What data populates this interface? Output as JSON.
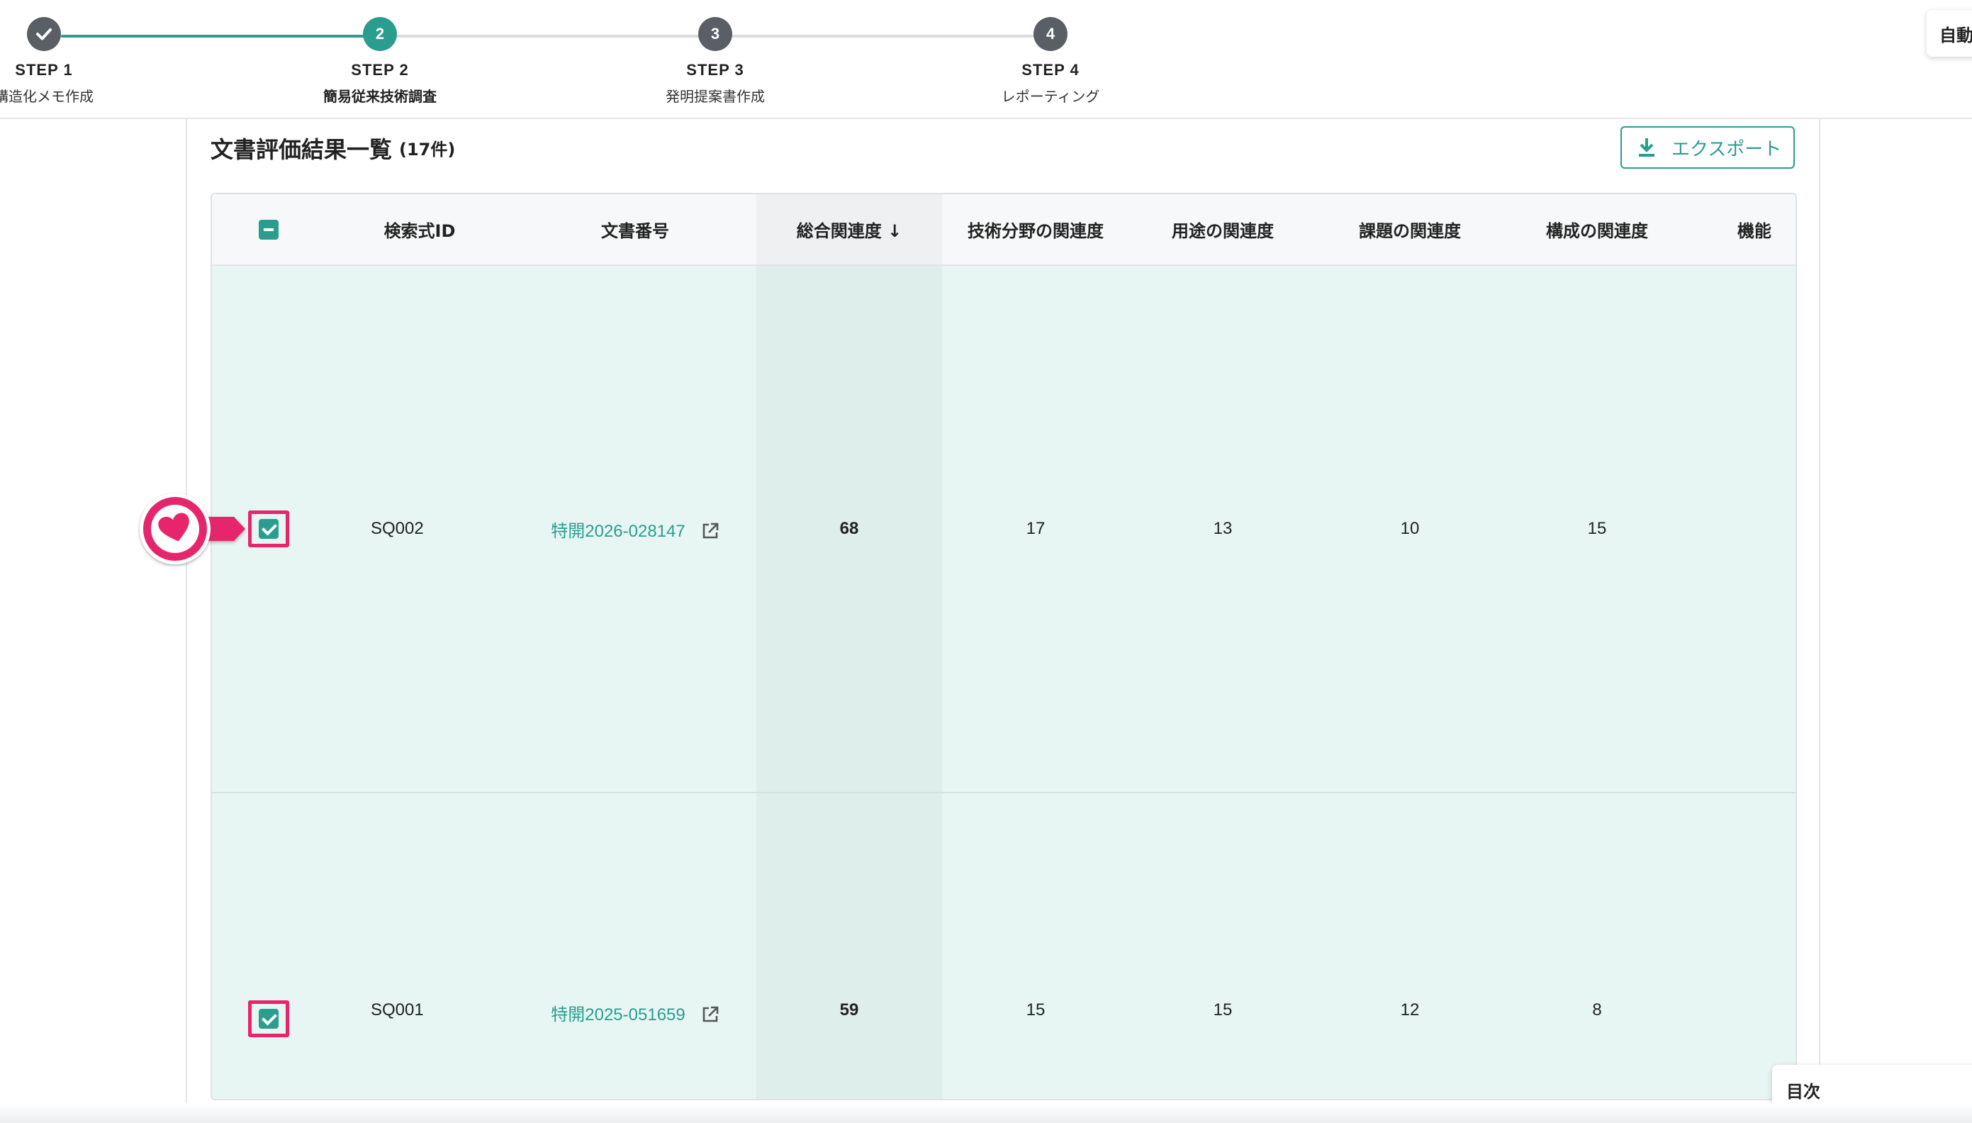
{
  "stepper": {
    "steps": [
      {
        "title": "STEP 1",
        "subtitle": "構造化メモ作成",
        "state": "done",
        "icon": "check-icon"
      },
      {
        "title": "STEP 2",
        "subtitle": "簡易従来技術調査",
        "state": "active",
        "number": "2"
      },
      {
        "title": "STEP 3",
        "subtitle": "発明提案書作成",
        "state": "todo",
        "number": "3"
      },
      {
        "title": "STEP 4",
        "subtitle": "レポーティング",
        "state": "todo",
        "number": "4"
      }
    ],
    "auto_label": "自動"
  },
  "section": {
    "title": "文書評価結果一覧",
    "count": "(17件)"
  },
  "export": {
    "label": "エクスポート",
    "icon": "download-icon"
  },
  "table": {
    "header_checkbox": "indeterminate",
    "columns": [
      "検索式ID",
      "文書番号",
      "総合関連度 ↓",
      "技術分野の関連度",
      "用途の関連度",
      "課題の関連度",
      "構成の関連度",
      "機能"
    ],
    "rows": [
      {
        "checked": true,
        "search_id": "SQ002",
        "doc_number": "特開2026-028147",
        "total": "68",
        "tech_field": "17",
        "usage": "13",
        "problem": "10",
        "structure": "15",
        "function": ""
      },
      {
        "checked": true,
        "search_id": "SQ001",
        "doc_number": "特開2025-051659",
        "total": "59",
        "tech_field": "15",
        "usage": "15",
        "problem": "12",
        "structure": "8",
        "function": ""
      }
    ]
  },
  "annotation": {
    "icon": "heart-icon"
  },
  "toc": {
    "label": "目次"
  },
  "colors": {
    "accent": "#2a9d8f",
    "highlight": "#e6256c",
    "row_selected_bg": "#e7f6f2",
    "sorted_col_bg": "#deeeeb"
  }
}
